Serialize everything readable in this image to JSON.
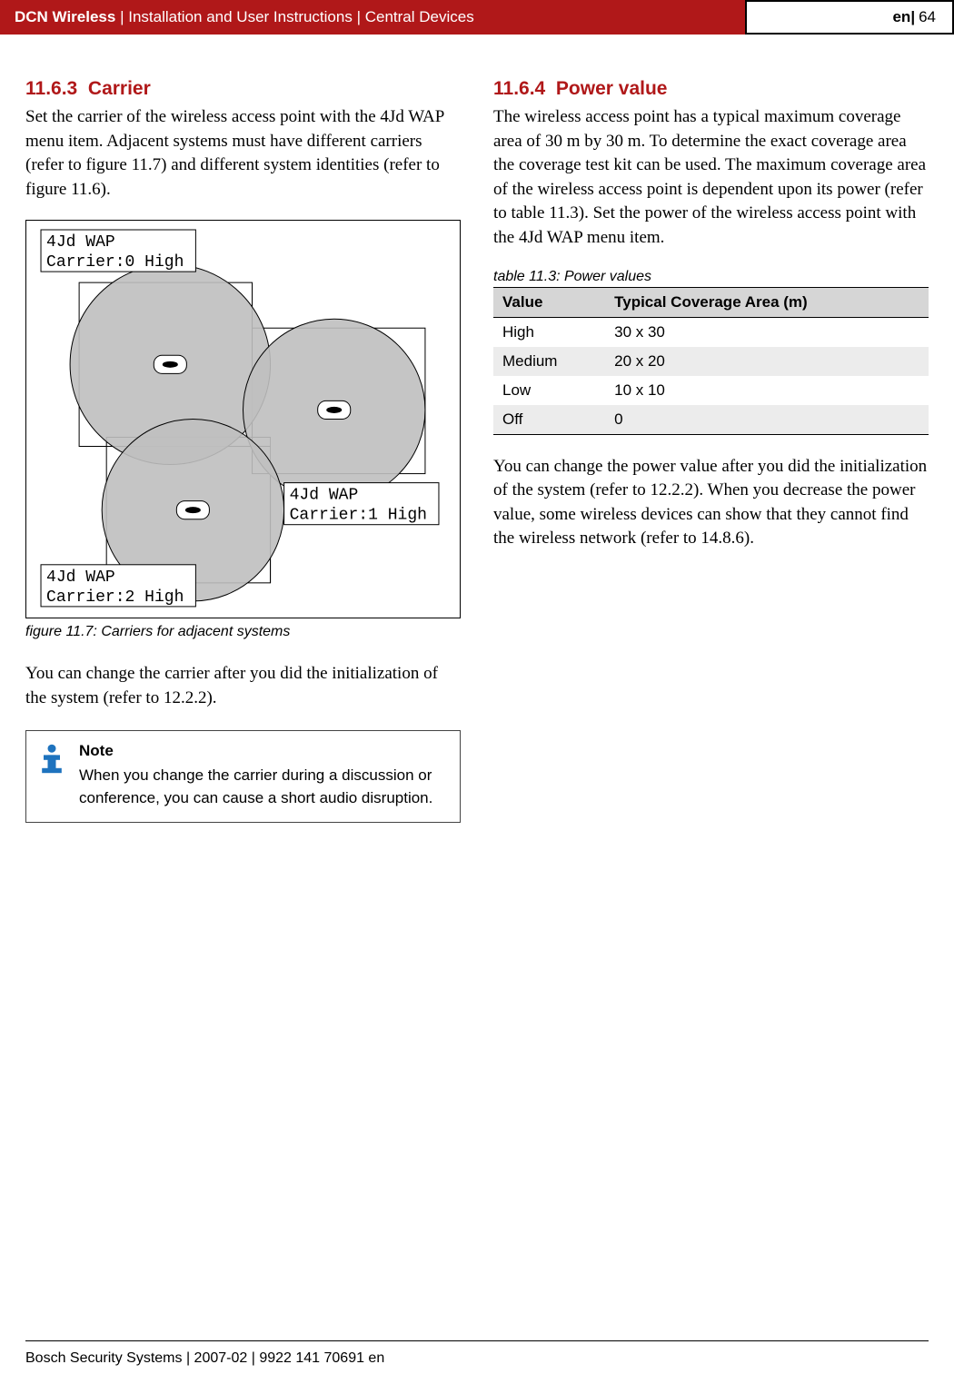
{
  "header": {
    "product": "DCN Wireless",
    "separator": " | ",
    "doc": "Installation and User Instructions",
    "chapter": "Central Devices",
    "lang": "en",
    "page": "64"
  },
  "left": {
    "section_no": "11.6.3",
    "section_title": "Carrier",
    "para1": "Set the carrier of the wireless access point with the 4Jd WAP menu item. Adjacent systems must have different carriers (refer to figure 11.7) and different system identities (refer to figure 11.6).",
    "fig": {
      "label0_top": "4Jd WAP",
      "label0_bot": "Carrier:0 High",
      "label1_top": "4Jd WAP",
      "label1_bot": "Carrier:1 High",
      "label2_top": "4Jd WAP",
      "label2_bot": "Carrier:2 High",
      "caption": "figure 11.7: Carriers for adjacent systems"
    },
    "para2": "You can change the carrier after you did the initialization of the system (refer to 12.2.2).",
    "note": {
      "label": "Note",
      "text": "When you change the carrier during a discussion or conference, you can cause a short audio disruption."
    }
  },
  "right": {
    "section_no": "11.6.4",
    "section_title": "Power value",
    "para1": "The wireless access point has a typical maximum coverage area of 30 m by 30 m. To determine the exact coverage area the coverage test kit can be used. The maximum coverage area of the wireless access point is dependent upon its power (refer to table 11.3). Set the power of the wireless access point with the 4Jd WAP menu item.",
    "table": {
      "caption": "table 11.3: Power values",
      "h1": "Value",
      "h2": "Typical Coverage Area (m)",
      "r1c1": "High",
      "r1c2": "30 x 30",
      "r2c1": "Medium",
      "r2c2": "20 x 20",
      "r3c1": "Low",
      "r3c2": "10 x 10",
      "r4c1": "Off",
      "r4c2": "0"
    },
    "para2": "You can change the power value after you did the initialization of the system (refer to 12.2.2). When you decrease the power value, some wireless devices can show that they cannot find the wireless network (refer to 14.8.6)."
  },
  "chart_data": {
    "type": "table",
    "title": "table 11.3: Power values",
    "columns": [
      "Value",
      "Typical Coverage Area (m)"
    ],
    "rows": [
      [
        "High",
        "30 x 30"
      ],
      [
        "Medium",
        "20 x 20"
      ],
      [
        "Low",
        "10 x 10"
      ],
      [
        "Off",
        "0"
      ]
    ]
  },
  "footer": {
    "text": "Bosch Security Systems | 2007-02 | 9922 141 70691 en"
  }
}
